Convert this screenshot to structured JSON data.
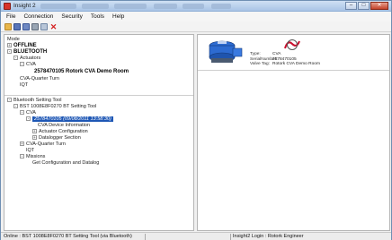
{
  "window": {
    "title": "Insight 2",
    "buttons": {
      "minimize": "–",
      "maximize": "□",
      "close": "✕"
    }
  },
  "menu": [
    "File",
    "Connection",
    "Security",
    "Tools",
    "Help"
  ],
  "toolbar": [
    "folder-icon",
    "save-icon",
    "save-as-icon",
    "print-icon",
    "connect-icon",
    "delete-icon"
  ],
  "tree": {
    "mode": "Mode",
    "offline": "OFFLINE",
    "bluetooth": "BLUETOOTH",
    "actuators": "Actuators",
    "cva1": "CVA",
    "device1": "2578470105 Rotork CVA Demo Room",
    "cva_quarter_turn_1": "CVA-Quarter Turn",
    "iqt1": "IQT",
    "bt_setting_tool": "Bluetooth Setting Tool",
    "bst_item": "BST 1008E8F0270 BT Setting Tool",
    "cva2": "CVA",
    "device2": "2578470105 (09/08/2011 13:58:30)",
    "cva_device_info": "CVA Device Information",
    "actuator_config": "Actuator Configuration",
    "datalogger": "Datalogger Section",
    "cva_quarter_turn_2": "CVA-Quarter Turn",
    "iqt2": "IQT",
    "missions": "Missions",
    "get_config": "Get Configuration and Datalog"
  },
  "device_info": {
    "type_label": "Type:",
    "type_value": "CVA",
    "serial_label": "SerialNumber:",
    "serial_value": "2578470105",
    "tag_label": "Valve Tag:",
    "tag_value": "Rotork CVA Demo Room"
  },
  "status": {
    "left": "Online : BST 1008E8F0270 BT Setting Tool (via Bluetooth)",
    "right": "Insight2 Login : Rotork Engineer"
  },
  "colors": {
    "selection": "#1e57b5",
    "logo_red": "#c8102e",
    "device_blue": "#2d6bd1"
  }
}
